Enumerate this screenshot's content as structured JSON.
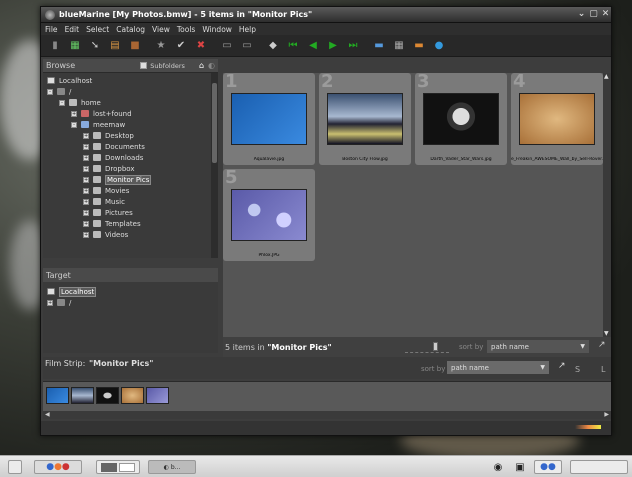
{
  "window": {
    "title": "blueMarine [My Photos.bmw] - 5 items in \"Monitor Pics\""
  },
  "menu": [
    "File",
    "Edit",
    "Select",
    "Catalog",
    "View",
    "Tools",
    "Window",
    "Help"
  ],
  "browse": {
    "header": "Browse",
    "subfolders_label": "Subfolders",
    "tree": [
      {
        "label": "Localhost"
      },
      {
        "label": "/"
      },
      {
        "label": "home"
      },
      {
        "label": "lost+found"
      },
      {
        "label": "meemaw"
      },
      {
        "label": "Desktop"
      },
      {
        "label": "Documents"
      },
      {
        "label": "Downloads"
      },
      {
        "label": "Dropbox"
      },
      {
        "label": "Monitor Pics"
      },
      {
        "label": "Movies"
      },
      {
        "label": "Music"
      },
      {
        "label": "Pictures"
      },
      {
        "label": "Templates"
      },
      {
        "label": "Videos"
      }
    ]
  },
  "target": {
    "header": "Target",
    "tree": [
      {
        "label": "Localhost"
      },
      {
        "label": "/"
      }
    ]
  },
  "thumbnails": [
    {
      "num": "1",
      "caption": "Aqualavie.jpg",
      "color": "#1e6fc0"
    },
    {
      "num": "2",
      "caption": "Boston City Flow.jpg",
      "color": "#283850"
    },
    {
      "num": "3",
      "caption": "Darth_Vader_Star_Wars.jpg",
      "color": "#111111"
    },
    {
      "num": "4",
      "caption": "e_Freakin_AWESOME_Wall_by_Sell-Rover.jpg",
      "color": "#c89a5a"
    },
    {
      "num": "5",
      "caption": "Phlox.JPG",
      "color": "#6c6cb8"
    }
  ],
  "status": {
    "prefix": "5 items in",
    "folder": "\"Monitor Pics\"",
    "sort_label": "sort by",
    "sort_value": "path name"
  },
  "filmstrip": {
    "label": "Film Strip:",
    "folder": "\"Monitor Pics\"",
    "sort_label": "sort by",
    "sort_value": "path name",
    "letters": [
      "S",
      "L"
    ]
  },
  "taskbar": {
    "app_label": "b..."
  }
}
